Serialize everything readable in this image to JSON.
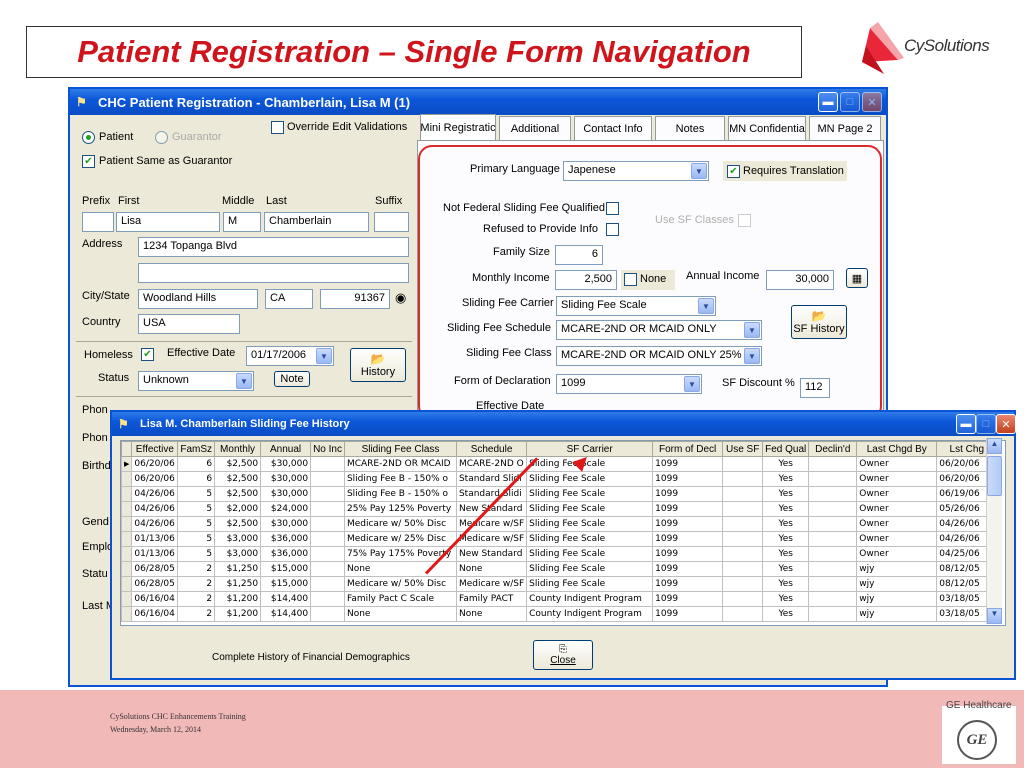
{
  "slide": {
    "title": "Patient Registration – Single Form Navigation",
    "logo_text": "CySolutions",
    "footer_line1": "CySolutions CHC Enhancements Training",
    "footer_line2": "Wednesday, March 12, 2014",
    "footer_brand": "GE Healthcare",
    "footer_brand_mark": "GE"
  },
  "colors": {
    "title_red": "#d0141c",
    "xp_blue": "#0a52d6",
    "footer_pink": "#f2b9b9",
    "highlight_red": "#d82a2a"
  },
  "main_window": {
    "title": "CHC Patient Registration  - Chamberlain, Lisa M (1)",
    "icon": "app-icon",
    "left": {
      "radio_patient": "Patient",
      "radio_guarantor": "Guarantor",
      "override_label": "Override Edit Validations",
      "same_as_guarantor": "Patient Same as Guarantor",
      "prefix_label": "Prefix",
      "first_label": "First",
      "middle_label": "Middle",
      "last_label": "Last",
      "suffix_label": "Suffix",
      "first_value": "Lisa",
      "middle_value": "M",
      "last_value": "Chamberlain",
      "address_label": "Address",
      "address_value": "1234 Topanga Blvd",
      "city_label": "City/State",
      "city_value": "Woodland Hills",
      "state_value": "CA",
      "zip_value": "91367",
      "country_label": "Country",
      "country_value": "USA",
      "homeless_label": "Homeless",
      "status_label": "Status",
      "effective_date_label": "Effective Date",
      "effective_date_value": "01/17/2006",
      "status_value": "Unknown",
      "note_button": "Note",
      "history_button": "History",
      "partial_labels": [
        "Phon",
        "Phon",
        "Birthd",
        "Gend",
        "Emplo",
        "Statu",
        "Last M"
      ]
    },
    "tabs": [
      "Mini Registratic",
      "Additional",
      "Contact Info",
      "Notes",
      "MN Confidentia",
      "MN Page 2"
    ],
    "panel": {
      "primary_language_label": "Primary Language",
      "primary_language_value": "Japenese",
      "requires_translation": "Requires Translation",
      "not_federal": "Not Federal Sliding Fee Qualified",
      "refused": "Refused to Provide Info",
      "use_sf_classes": "Use SF Classes",
      "family_size_label": "Family Size",
      "family_size_value": "6",
      "monthly_income_label": "Monthly Income",
      "monthly_income_value": "2,500",
      "none_label": "None",
      "annual_income_label": "Annual Income",
      "annual_income_value": "30,000",
      "carrier_label": "Sliding Fee Carrier",
      "carrier_value": "Sliding Fee Scale",
      "schedule_label": "Sliding Fee Schedule",
      "schedule_value": "MCARE-2ND OR MCAID ONLY",
      "class_label": "Sliding Fee Class",
      "class_value": "MCARE-2ND OR MCAID ONLY 25%",
      "declaration_label": "Form of Declaration",
      "declaration_value": "1099",
      "sf_discount_label": "SF Discount %",
      "sf_discount_value": "112",
      "sf_history_button": "SF History",
      "effective_date_label": "Effective Date"
    }
  },
  "history_window": {
    "title": "Lisa M. Chamberlain Sliding Fee History",
    "columns": [
      "Effective",
      "FamSz",
      "Monthly",
      "Annual",
      "No Inc",
      "Sliding Fee Class",
      "Schedule",
      "SF Carrier",
      "Form of Decl",
      "Use SF",
      "Fed Qual",
      "Declin'd",
      "Last Chgd By",
      "Lst Chg"
    ],
    "rows": [
      [
        "06/20/06",
        "6",
        "$2,500",
        "$30,000",
        "",
        "MCARE-2ND OR MCAID",
        "MCARE-2ND O",
        "Sliding Fee Scale",
        "1099",
        "",
        "Yes",
        "",
        "Owner",
        "06/20/06"
      ],
      [
        "06/20/06",
        "6",
        "$2,500",
        "$30,000",
        "",
        "Sliding Fee B - 150% o",
        "Standard Slidi",
        "Sliding Fee Scale",
        "1099",
        "",
        "Yes",
        "",
        "Owner",
        "06/20/06"
      ],
      [
        "04/26/06",
        "5",
        "$2,500",
        "$30,000",
        "",
        "Sliding Fee B - 150% o",
        "Standard Slidi",
        "Sliding Fee Scale",
        "1099",
        "",
        "Yes",
        "",
        "Owner",
        "06/19/06"
      ],
      [
        "04/26/06",
        "5",
        "$2,000",
        "$24,000",
        "",
        "25% Pay 125% Poverty",
        "New Standard",
        "Sliding Fee Scale",
        "1099",
        "",
        "Yes",
        "",
        "Owner",
        "05/26/06"
      ],
      [
        "04/26/06",
        "5",
        "$2,500",
        "$30,000",
        "",
        "Medicare w/ 50% Disc",
        "Medicare w/SF",
        "Sliding Fee Scale",
        "1099",
        "",
        "Yes",
        "",
        "Owner",
        "04/26/06"
      ],
      [
        "01/13/06",
        "5",
        "$3,000",
        "$36,000",
        "",
        "Medicare w/ 25% Disc",
        "Medicare w/SF",
        "Sliding Fee Scale",
        "1099",
        "",
        "Yes",
        "",
        "Owner",
        "04/26/06"
      ],
      [
        "01/13/06",
        "5",
        "$3,000",
        "$36,000",
        "",
        "75% Pay 175% Poverty",
        "New Standard",
        "Sliding Fee Scale",
        "1099",
        "",
        "Yes",
        "",
        "Owner",
        "04/25/06"
      ],
      [
        "06/28/05",
        "2",
        "$1,250",
        "$15,000",
        "",
        "None",
        "None",
        "Sliding Fee Scale",
        "1099",
        "",
        "Yes",
        "",
        "wjy",
        "08/12/05"
      ],
      [
        "06/28/05",
        "2",
        "$1,250",
        "$15,000",
        "",
        "Medicare w/ 50% Disc",
        "Medicare w/SF",
        "Sliding Fee Scale",
        "1099",
        "",
        "Yes",
        "",
        "wjy",
        "08/12/05"
      ],
      [
        "06/16/04",
        "2",
        "$1,200",
        "$14,400",
        "",
        "Family Pact C Scale",
        "Family PACT",
        "County Indigent Program",
        "1099",
        "",
        "Yes",
        "",
        "wjy",
        "03/18/05"
      ],
      [
        "06/16/04",
        "2",
        "$1,200",
        "$14,400",
        "",
        "None",
        "None",
        "County Indigent Program",
        "1099",
        "",
        "Yes",
        "",
        "wjy",
        "03/18/05"
      ]
    ],
    "caption": "Complete History of Financial Demographics",
    "close_button": "Close"
  }
}
